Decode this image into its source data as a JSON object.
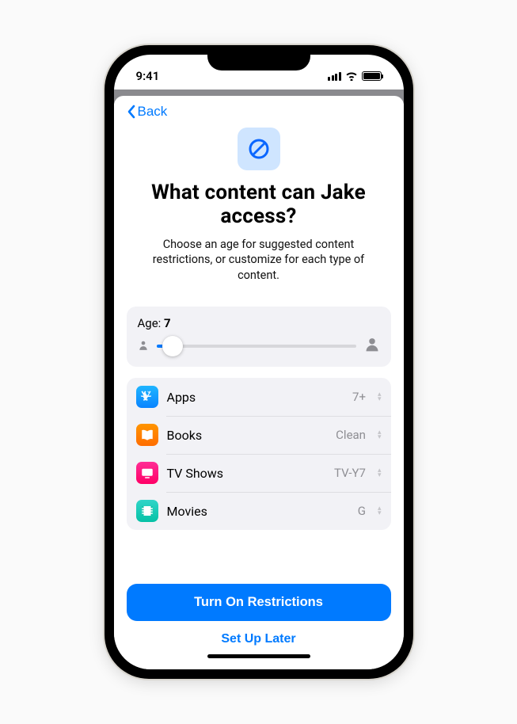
{
  "status": {
    "time": "9:41"
  },
  "nav": {
    "back_label": "Back"
  },
  "hero": {
    "title": "What content can Jake access?",
    "subtitle": "Choose an age for suggested content restrictions, or customize for each type of content."
  },
  "age": {
    "label_prefix": "Age: ",
    "value": "7",
    "percent": 8
  },
  "content_rows": [
    {
      "icon": "appstore",
      "label": "Apps",
      "value": "7+"
    },
    {
      "icon": "books",
      "label": "Books",
      "value": "Clean"
    },
    {
      "icon": "tv",
      "label": "TV Shows",
      "value": "TV-Y7"
    },
    {
      "icon": "movies",
      "label": "Movies",
      "value": "G"
    }
  ],
  "footer": {
    "primary": "Turn On Restrictions",
    "secondary": "Set Up Later"
  }
}
